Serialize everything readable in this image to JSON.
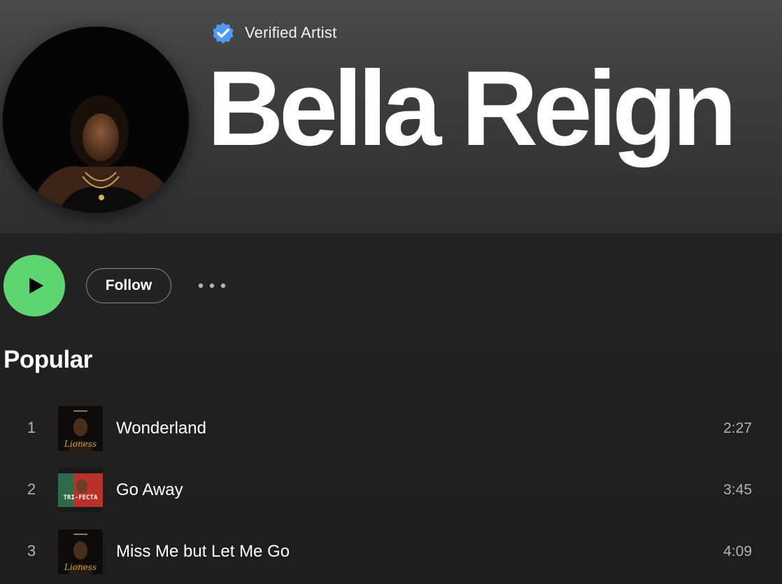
{
  "header": {
    "verified_label": "Verified Artist",
    "verified_icon": "verified-badge-icon",
    "artist_name": "Bella Reign"
  },
  "actions": {
    "play_icon": "play-icon",
    "follow_label": "Follow",
    "more_icon": "more-options-icon"
  },
  "popular": {
    "title": "Popular",
    "tracks": [
      {
        "number": "1",
        "title": "Wonderland",
        "duration": "2:27",
        "cover_text": "Lioness"
      },
      {
        "number": "2",
        "title": "Go Away",
        "duration": "3:45",
        "cover_text": "TRI-FECTA"
      },
      {
        "number": "3",
        "title": "Miss Me but Let Me Go",
        "duration": "4:09",
        "cover_text": "Lioness"
      }
    ]
  },
  "colors": {
    "accent_green": "#5fd571",
    "verified_blue": "#4c9bf7",
    "background": "#1f1f1f"
  }
}
